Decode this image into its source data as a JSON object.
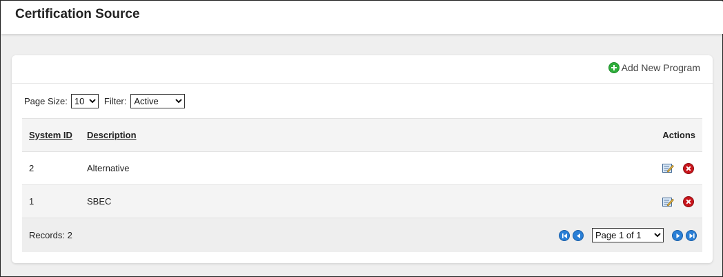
{
  "header": {
    "title": "Certification Source"
  },
  "toolbar": {
    "add_label": "Add New Program",
    "add_icon": "plus-circle-icon"
  },
  "filters": {
    "page_size_label": "Page Size:",
    "page_size_value": "10",
    "filter_label": "Filter:",
    "filter_value": "Active"
  },
  "table": {
    "columns": {
      "system_id": "System ID",
      "description": "Description",
      "actions": "Actions"
    },
    "rows": [
      {
        "system_id": "2",
        "description": "Alternative"
      },
      {
        "system_id": "1",
        "description": "SBEC"
      }
    ]
  },
  "footer": {
    "records_label": "Records: 2",
    "page_value": "Page 1 of 1"
  },
  "colors": {
    "add_icon": "#2fae3b",
    "delete_icon": "#c8141b",
    "nav_icon": "#2a7fd6"
  }
}
